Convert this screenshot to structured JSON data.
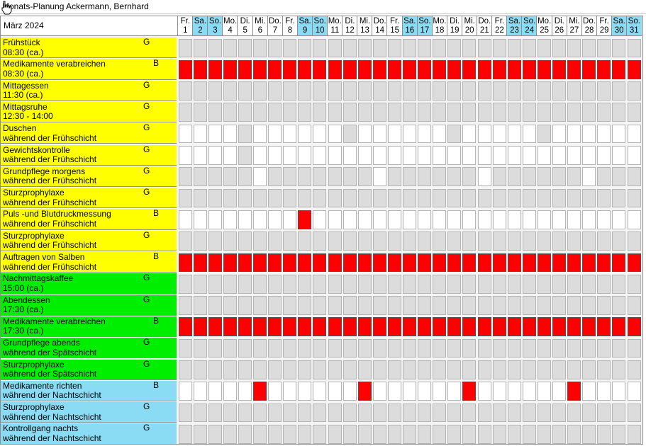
{
  "window": {
    "title": "Monats-Planung Ackermann, Bernhard"
  },
  "month": "März 2024",
  "days": [
    {
      "dow": "Fr.",
      "num": "1",
      "weekend": false
    },
    {
      "dow": "Sa.",
      "num": "2",
      "weekend": true
    },
    {
      "dow": "So.",
      "num": "3",
      "weekend": true
    },
    {
      "dow": "Mo.",
      "num": "4",
      "weekend": false
    },
    {
      "dow": "Di.",
      "num": "5",
      "weekend": false
    },
    {
      "dow": "Mi.",
      "num": "6",
      "weekend": false
    },
    {
      "dow": "Do.",
      "num": "7",
      "weekend": false
    },
    {
      "dow": "Fr.",
      "num": "8",
      "weekend": false
    },
    {
      "dow": "Sa.",
      "num": "9",
      "weekend": true
    },
    {
      "dow": "So.",
      "num": "10",
      "weekend": true
    },
    {
      "dow": "Mo.",
      "num": "11",
      "weekend": false
    },
    {
      "dow": "Di.",
      "num": "12",
      "weekend": false
    },
    {
      "dow": "Mi.",
      "num": "13",
      "weekend": false
    },
    {
      "dow": "Do.",
      "num": "14",
      "weekend": false
    },
    {
      "dow": "Fr.",
      "num": "15",
      "weekend": false
    },
    {
      "dow": "Sa.",
      "num": "16",
      "weekend": true
    },
    {
      "dow": "So.",
      "num": "17",
      "weekend": true
    },
    {
      "dow": "Mo.",
      "num": "18",
      "weekend": false
    },
    {
      "dow": "Di.",
      "num": "19",
      "weekend": false
    },
    {
      "dow": "Mi.",
      "num": "20",
      "weekend": false
    },
    {
      "dow": "Do.",
      "num": "21",
      "weekend": false
    },
    {
      "dow": "Fr.",
      "num": "22",
      "weekend": false
    },
    {
      "dow": "Sa.",
      "num": "23",
      "weekend": true
    },
    {
      "dow": "So.",
      "num": "24",
      "weekend": true
    },
    {
      "dow": "Mo.",
      "num": "25",
      "weekend": false
    },
    {
      "dow": "Di.",
      "num": "26",
      "weekend": false
    },
    {
      "dow": "Mi.",
      "num": "27",
      "weekend": false
    },
    {
      "dow": "Do.",
      "num": "28",
      "weekend": false
    },
    {
      "dow": "Fr.",
      "num": "29",
      "weekend": false
    },
    {
      "dow": "Sa.",
      "num": "30",
      "weekend": true
    },
    {
      "dow": "So.",
      "num": "31",
      "weekend": true
    }
  ],
  "colors": {
    "yellow": "#ffff00",
    "green": "#00ee00",
    "blue": "#8adcf5",
    "planned": "#ff0000",
    "open": "#ffffff",
    "unavailable": "#dcdcdc"
  },
  "tasks": [
    {
      "line1": "Frühstück",
      "line2": "08:30 (ca.)",
      "code": "G",
      "color": "yellow",
      "cells": "ggggggggggggggggggggggggggggggg"
    },
    {
      "line1": "Medikamente verabreichen",
      "line2": "08:30 (ca.)",
      "code": "B",
      "color": "yellow",
      "cells": "rrrrrrrrrrrrrrrrrrrrrrrrrrrrrrr"
    },
    {
      "line1": "Mittagessen",
      "line2": "11:30 (ca.)",
      "code": "G",
      "color": "yellow",
      "cells": "ggggggggggggggggggggggggggggggg"
    },
    {
      "line1": "Mittagsruhe",
      "line2": "12:30 - 14:00",
      "code": "G",
      "color": "yellow",
      "cells": "ggggggggggggggggggggggggggggggg"
    },
    {
      "line1": "Duschen",
      "line2": "während der Frühschicht",
      "code": "G",
      "color": "yellow",
      "cells": "wwwwgwwwwwwgwwwwwwgwwwwwgwwwwww"
    },
    {
      "line1": "Gewichtskontrolle",
      "line2": "während der Frühschicht",
      "code": "G",
      "color": "yellow",
      "cells": "wwwwgwwwwwwwwwwwwwwwwwwwwwwwwww"
    },
    {
      "line1": "Grundpflege morgens",
      "line2": "während der Frühschicht",
      "code": "G",
      "color": "yellow",
      "cells": "gggggwgggggggwggggggwggggggwggg"
    },
    {
      "line1": "Sturzprophylaxe",
      "line2": "während der Frühschicht",
      "code": "G",
      "color": "yellow",
      "cells": "ggggggggggggggggggggggggggggggg"
    },
    {
      "line1": "Puls -und Blutdruckmessung",
      "line2": "während der Frühschicht",
      "code": "B",
      "color": "yellow",
      "cells": "wwwwwwwwrwwwwwwwwwwwwwwwwwwwwww"
    },
    {
      "line1": "Sturzprophylaxe",
      "line2": "während der Frühschicht",
      "code": "G",
      "color": "yellow",
      "cells": "ggggggggggggggggggggggggggggggg"
    },
    {
      "line1": "Auftragen von Salben",
      "line2": "während der Frühschicht",
      "code": "B",
      "color": "yellow",
      "cells": "rrrrrrrrrrrrrrrrrrrrrrrrrrrrrrr"
    },
    {
      "line1": "Nachmittagskaffee",
      "line2": "15:00 (ca.)",
      "code": "G",
      "color": "green",
      "cells": "ggggggggggggggggggggggggggggggg"
    },
    {
      "line1": "Abendessen",
      "line2": "17:30 (ca.)",
      "code": "G",
      "color": "green",
      "cells": "ggggggggggggggggggggggggggggggg"
    },
    {
      "line1": "Medikamente verabreichen",
      "line2": "17:30 (ca.)",
      "code": "B",
      "color": "green",
      "cells": "rrrrrrrrrrrrrrrrrrrrrrrrrrrrrrr"
    },
    {
      "line1": "Grundpflege abends",
      "line2": "während der Spätschicht",
      "code": "G",
      "color": "green",
      "cells": "ggggggggggggggggggggggggggggggg"
    },
    {
      "line1": "Sturzprophylaxe",
      "line2": "während der Spätschicht",
      "code": "G",
      "color": "green",
      "cells": "ggggggggggggggggggggggggggggggg"
    },
    {
      "line1": "Medikamente richten",
      "line2": "während der Nachtschicht",
      "code": "B",
      "color": "blue",
      "cells": "wwwwwrwwwwwwrwwwwwwrwwwwwwrwwww"
    },
    {
      "line1": "Sturzprophylaxe",
      "line2": "während der Nachtschicht",
      "code": "G",
      "color": "blue",
      "cells": "ggggggggggggggggggggggggggggggg"
    },
    {
      "line1": "Kontrollgang nachts",
      "line2": "während der Nachtschicht",
      "code": "G",
      "color": "blue",
      "cells": "ggggggggggggggggggggggggggggggg"
    }
  ]
}
